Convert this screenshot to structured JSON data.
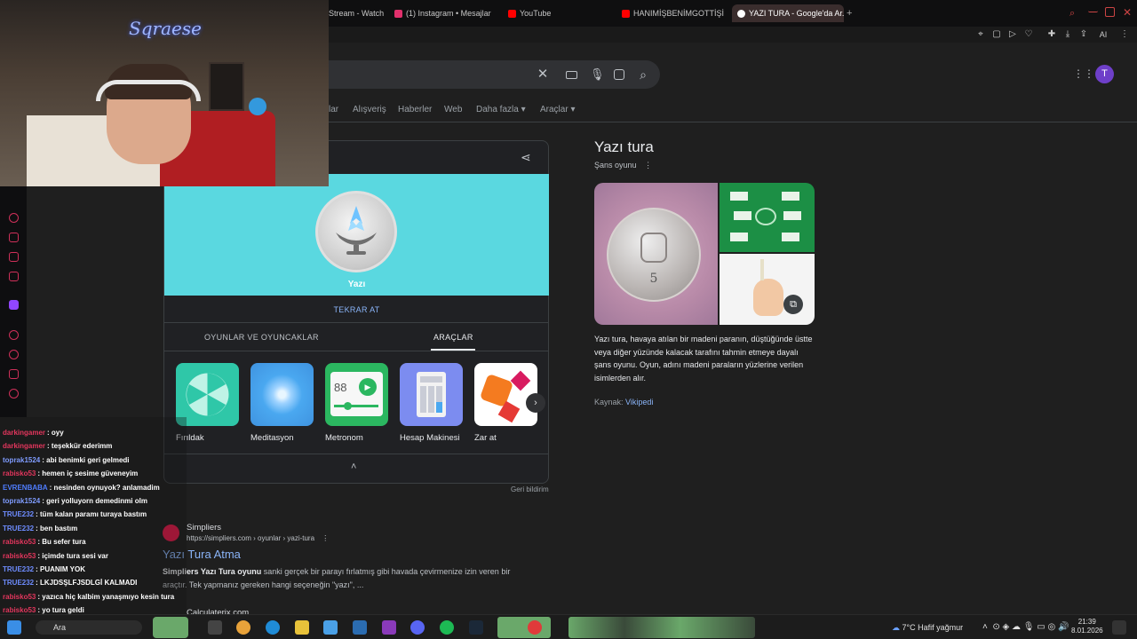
{
  "browser": {
    "tabs": [
      {
        "label": "Stream - Watch",
        "color": "#d0305a"
      },
      {
        "label": "(1) Instagram • Mesajlar",
        "color": "#e1306c"
      },
      {
        "label": "YouTube",
        "color": "#ff0000"
      },
      {
        "label": "HANIMİŞBENİMGOTTİŞİM...",
        "color": "#ff0000"
      },
      {
        "label": "YAZI TURA - Google'da Ar...",
        "color": "#ffffff"
      }
    ],
    "new_tab": "+",
    "ai_label": "AI"
  },
  "search": {
    "clear_icon": "close-icon",
    "keyboard_icon": "keyboard-icon",
    "mic_icon": "mic-icon",
    "lens_icon": "lens-icon",
    "search_icon": "search-icon",
    "avatar_letter": "T",
    "avatar_color": "#7b4fd6"
  },
  "nav": [
    {
      "label": "lar"
    },
    {
      "label": "Alışveriş"
    },
    {
      "label": "Haberler"
    },
    {
      "label": "Web"
    },
    {
      "label": "Daha fazla ▾"
    },
    {
      "label": "Araçlar ▾"
    }
  ],
  "coin_widget": {
    "coin_text": "Yazı",
    "retry_label": "TEKRAR AT",
    "tabs": [
      "OYUNLAR VE OYUNCAKLAR",
      "ARAÇLAR"
    ],
    "tools": [
      {
        "label": "Fırıldak",
        "color": "#2fc7a8"
      },
      {
        "label": "Meditasyon",
        "color": "#4aa8f0"
      },
      {
        "label": "Metronom",
        "color": "#2bb760"
      },
      {
        "label": "Hesap Makinesi",
        "color": "#7c8cf0"
      },
      {
        "label": "Zar at",
        "color": "#ffffff"
      }
    ],
    "metronome_value": "88",
    "feedback": "Geri bildirim"
  },
  "knowledge_panel": {
    "title": "Yazı tura",
    "subtitle": "Şans oyunu",
    "description": "Yazı tura, havaya atılan bir madeni paranın, düştüğünde üstte veya diğer yüzünde kalacak tarafını tahmin etmeye dayalı şans oyunu. Oyun, adını madeni paraların yüzlerine verilen isimlerden alır.",
    "source_label": "Kaynak:",
    "source_link": "Vikipedi",
    "coin_number": "5"
  },
  "result": {
    "site_name": "Simpliers",
    "url": "https://simpliers.com › oyunlar › yazi-tura",
    "title": "Yazı Tura Atma",
    "snippet_bold": "Simpliers Yazı Tura oyunu",
    "snippet_rest": " sanki gerçek bir parayı fırlatmış gibi havada çevirmenize izin veren bir araçtır. Tek yapmanız gereken hangi seçeneğin \"yazı\", ...",
    "next_site": "Calculaterix.com"
  },
  "stream": {
    "logo_text": "Sqraese"
  },
  "chat": [
    {
      "user": "darkingamer",
      "color": "#e3365d",
      "msg": ": oyy"
    },
    {
      "user": "darkingamer",
      "color": "#e3365d",
      "msg": ": teşekkür ederimm"
    },
    {
      "user": "toprak1524",
      "color": "#7f9cff",
      "msg": ": abi benimki geri gelmedi"
    },
    {
      "user": "rabisko53",
      "color": "#e3365d",
      "msg": ": hemen iç sesime güveneyim"
    },
    {
      "user": "EVRENBABA",
      "color": "#4f7dff",
      "msg": ": nesinden oynuyok? anlamadim"
    },
    {
      "user": "toprak1524",
      "color": "#7f9cff",
      "msg": ": geri yolluyorn demedinmi olm"
    },
    {
      "user": "TRUE232",
      "color": "#6e8cff",
      "msg": ": tüm kalan paramı turaya bastım"
    },
    {
      "user": "TRUE232",
      "color": "#6e8cff",
      "msg": ": ben bastım"
    },
    {
      "user": "rabisko53",
      "color": "#e3365d",
      "msg": ": Bu sefer tura"
    },
    {
      "user": "rabisko53",
      "color": "#e3365d",
      "msg": ": içimde tura sesi var"
    },
    {
      "user": "TRUE232",
      "color": "#6e8cff",
      "msg": ": PUANIM YOK"
    },
    {
      "user": "TRUE232",
      "color": "#6e8cff",
      "msg": ": LKJDSŞLFJSDLGİ KALMADI"
    },
    {
      "user": "rabisko53",
      "color": "#e3365d",
      "msg": ": yazıca hiç kalbim yanaşmıyo kesin tura"
    },
    {
      "user": "rabisko53",
      "color": "#e3365d",
      "msg": ": yo tura geldi"
    }
  ],
  "taskbar": {
    "search_label": "Ara",
    "weather": "7°C  Hafif yağmur",
    "time": "21:39",
    "date": "8.01.2026"
  }
}
